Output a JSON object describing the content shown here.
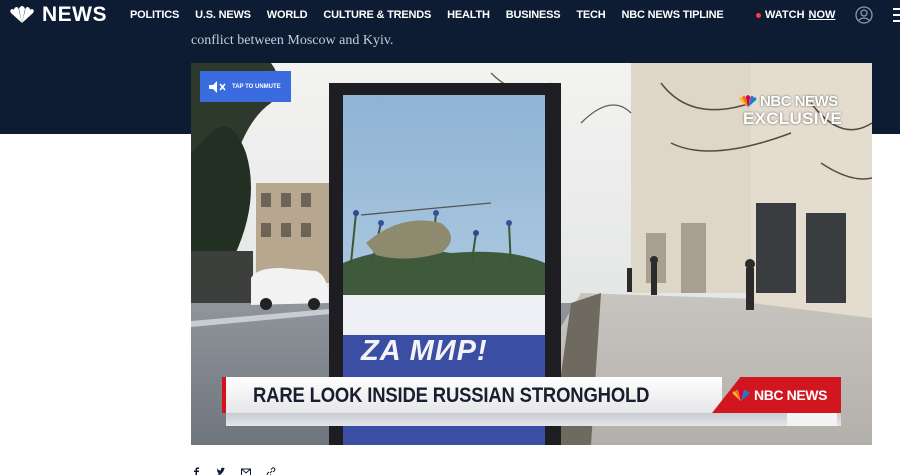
{
  "header": {
    "logo_text": "NEWS",
    "nav": [
      "POLITICS",
      "U.S. NEWS",
      "WORLD",
      "CULTURE & TRENDS",
      "HEALTH",
      "BUSINESS",
      "TECH",
      "NBC NEWS TIPLINE"
    ],
    "watch_label": "WATCH",
    "watch_now": "NOW",
    "icons": {
      "logo": "nbc-peacock-icon",
      "account": "account-icon",
      "menu": "menu-icon",
      "live": "live-dot-icon"
    }
  },
  "article": {
    "intro_text": "conflict between Moscow and Kyiv."
  },
  "video": {
    "unmute_label": "TAP TO UNMUTE",
    "bug_brand": "NBC NEWS",
    "bug_exclusive": "EXCLUSIVE",
    "poster_slogan": "ZA МИР!",
    "lower_third_headline": "RARE LOOK INSIDE RUSSIAN STRONGHOLD",
    "lower_third_brand": "NBC NEWS",
    "icons": {
      "unmute": "muted-speaker-icon"
    }
  },
  "share": {
    "icons": [
      "facebook-icon",
      "twitter-icon",
      "email-icon",
      "link-icon"
    ]
  },
  "colors": {
    "header_bg": "#0d1b33",
    "accent_red": "#d11620",
    "unmute_blue": "#3a6ce0",
    "live_dot": "#ff3b3b"
  }
}
